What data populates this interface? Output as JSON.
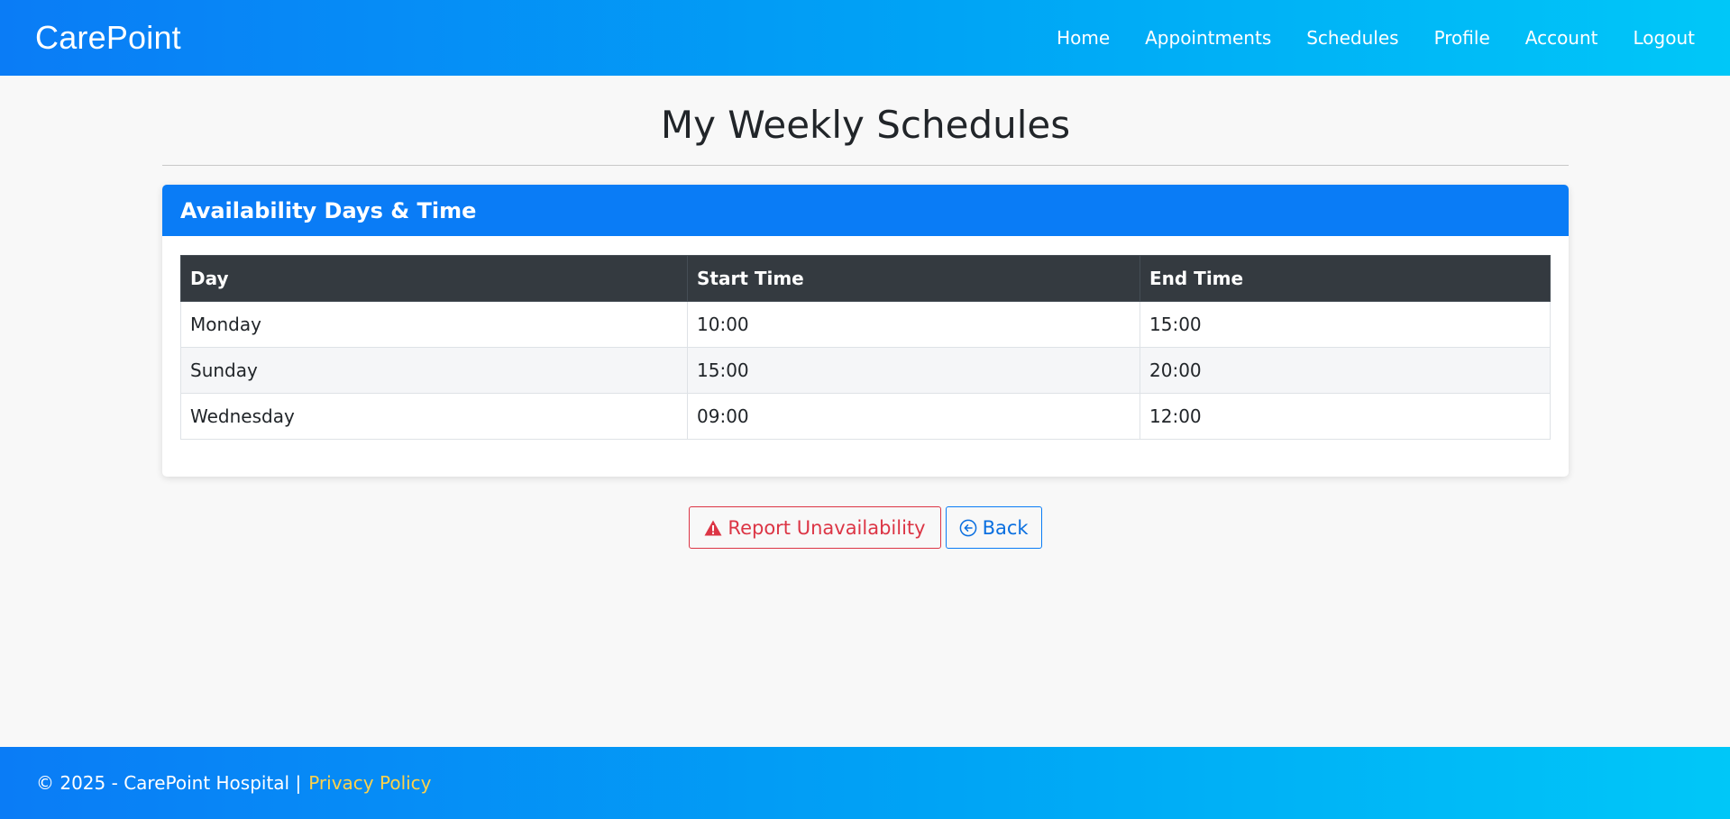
{
  "navbar": {
    "brand": "CarePoint",
    "links": [
      "Home",
      "Appointments",
      "Schedules",
      "Profile",
      "Account",
      "Logout"
    ]
  },
  "page": {
    "title": "My Weekly Schedules"
  },
  "card": {
    "header": "Availability Days & Time",
    "columns": [
      "Day",
      "Start Time",
      "End Time"
    ],
    "rows": [
      [
        "Monday",
        "10:00",
        "15:00"
      ],
      [
        "Sunday",
        "15:00",
        "20:00"
      ],
      [
        "Wednesday",
        "09:00",
        "12:00"
      ]
    ]
  },
  "actions": {
    "report_label": "Report Unavailability",
    "report_icon": "warning-triangle-icon",
    "back_label": "Back",
    "back_icon": "arrow-left-circle-icon"
  },
  "footer": {
    "copyright": "© 2025 - CarePoint Hospital |",
    "privacy_link": "Privacy Policy"
  },
  "colors": {
    "primary": "#0a7cf6",
    "danger": "#dc3545",
    "table_header": "#343a40",
    "footer_link": "#ffd24a"
  }
}
